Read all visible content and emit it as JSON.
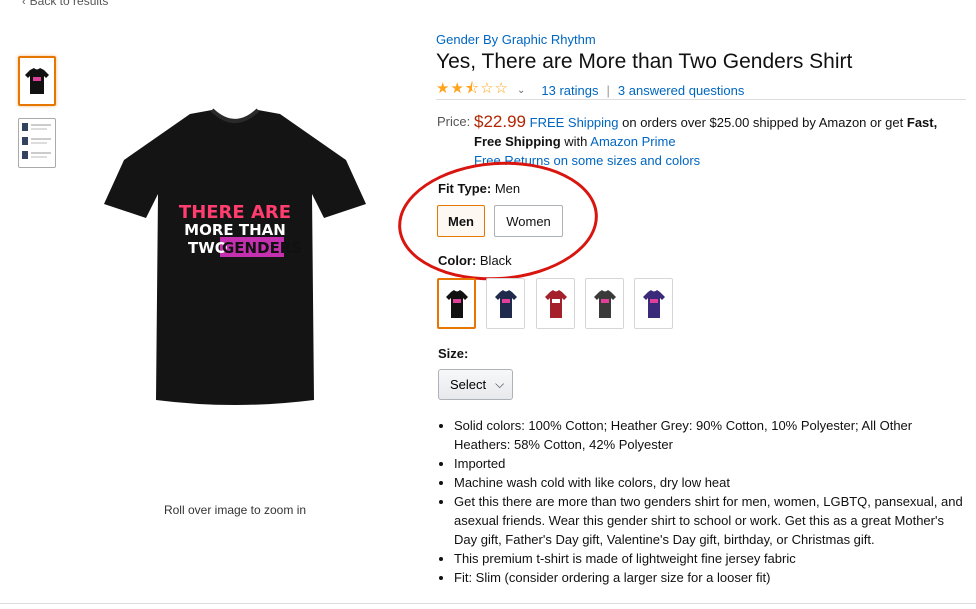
{
  "nav": {
    "back_label": "Back to results"
  },
  "gallery": {
    "zoom_hint": "Roll over image to zoom in",
    "shirt_text_line1": "THERE ARE",
    "shirt_text_line2": "MORE THAN",
    "shirt_text_line3a": "TWO ",
    "shirt_text_line3b": "GENDERS"
  },
  "product": {
    "brand": "Gender By Graphic Rhythm",
    "title": "Yes, There are More than Two Genders Shirt",
    "rating_stars": 2.5,
    "ratings_label": "13 ratings",
    "answered_label": "3 answered questions"
  },
  "price": {
    "label": "Price:",
    "amount": "$22.99",
    "free_shipping_link": "FREE Shipping",
    "shipping_text": " on orders over $25.00 shipped by Amazon or get ",
    "fast_text": "Fast, Free Shipping",
    "with_text": " with ",
    "prime_link": "Amazon Prime",
    "returns_link": "Free Returns on some sizes and colors"
  },
  "fit": {
    "label": "Fit Type: ",
    "selected": "Men",
    "options": [
      "Men",
      "Women"
    ]
  },
  "color": {
    "label": "Color: ",
    "selected": "Black",
    "swatches": [
      "#111111",
      "#1f2a4d",
      "#a4202a",
      "#3a3a3a",
      "#3b2a7a"
    ]
  },
  "size": {
    "label": "Size:",
    "select_label": "Select"
  },
  "features": [
    "Solid colors: 100% Cotton; Heather Grey: 90% Cotton, 10% Polyester; All Other Heathers: 58% Cotton, 42% Polyester",
    "Imported",
    "Machine wash cold with like colors, dry low heat",
    "Get this there are more than two genders shirt for men, women, LGBTQ, pansexual, and asexual friends. Wear this gender shirt to school or work. Get this as a great Mother's Day gift, Father's Day gift, Valentine's Day gift, birthday, or Christmas gift.",
    "This premium t-shirt is made of lightweight fine jersey fabric",
    "Fit: Slim (consider ordering a larger size for a looser fit)"
  ]
}
